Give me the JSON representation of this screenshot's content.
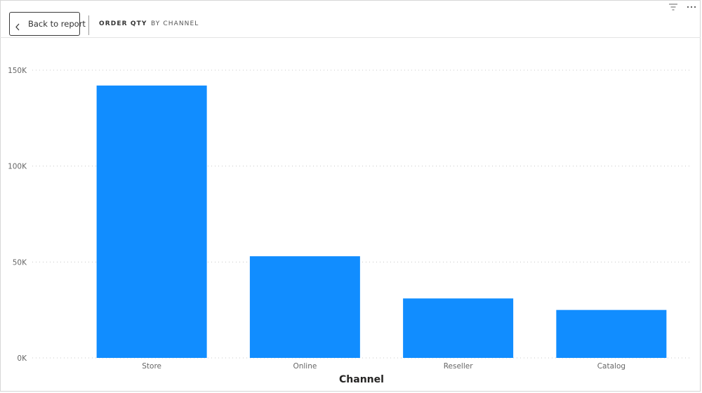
{
  "header": {
    "back_label": "Back to report",
    "title": "ORDER QTY",
    "subtitle": "BY CHANNEL"
  },
  "icons": {
    "filter": "filter-icon",
    "more": "more-options-icon",
    "back": "chevron-left-icon"
  },
  "colors": {
    "bar": "#118DFF",
    "grid": "#c8c8c8",
    "tick_text": "#666666",
    "axis_title": "#252423"
  },
  "chart_data": {
    "type": "bar",
    "categories": [
      "Store",
      "Online",
      "Reseller",
      "Catalog"
    ],
    "values": [
      142000,
      53000,
      31000,
      25000
    ],
    "xlabel": "Channel",
    "ylabel": "",
    "ylim": [
      0,
      150000
    ],
    "yticks": [
      0,
      50000,
      100000,
      150000
    ],
    "ytick_labels": [
      "0K",
      "50K",
      "100K",
      "150K"
    ],
    "grid": true,
    "legend": "none"
  }
}
